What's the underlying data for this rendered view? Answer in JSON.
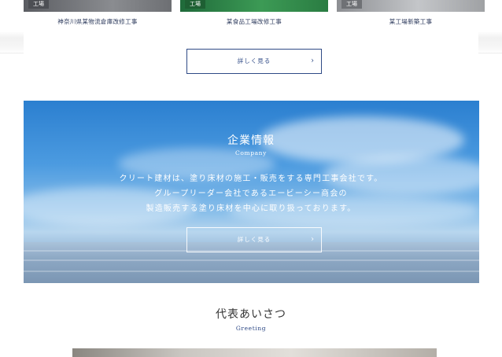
{
  "works": {
    "cards": [
      {
        "tag": "工場",
        "title": "神奈川県某物流倉庫改修工事"
      },
      {
        "tag": "工場",
        "title": "某食品工場改修工事"
      },
      {
        "tag": "工場",
        "title": "某工場新築工事"
      }
    ],
    "more_label": "詳しく見る",
    "arrow": "›"
  },
  "company": {
    "title": "企業情報",
    "subtitle": "Company",
    "lines": [
      "クリート建材は、塗り床材の施工・販売をする専門工事会社です。",
      "グループリーダー会社であるエービーシー商会の",
      "製造販売する塗り床材を中心に取り扱っております。"
    ],
    "more_label": "詳しく見る",
    "arrow": "›"
  },
  "greeting": {
    "title": "代表あいさつ",
    "subtitle": "Greeting"
  },
  "colors": {
    "accent": "#2f4a86",
    "text": "#333333",
    "sky": "#4c9be0"
  }
}
